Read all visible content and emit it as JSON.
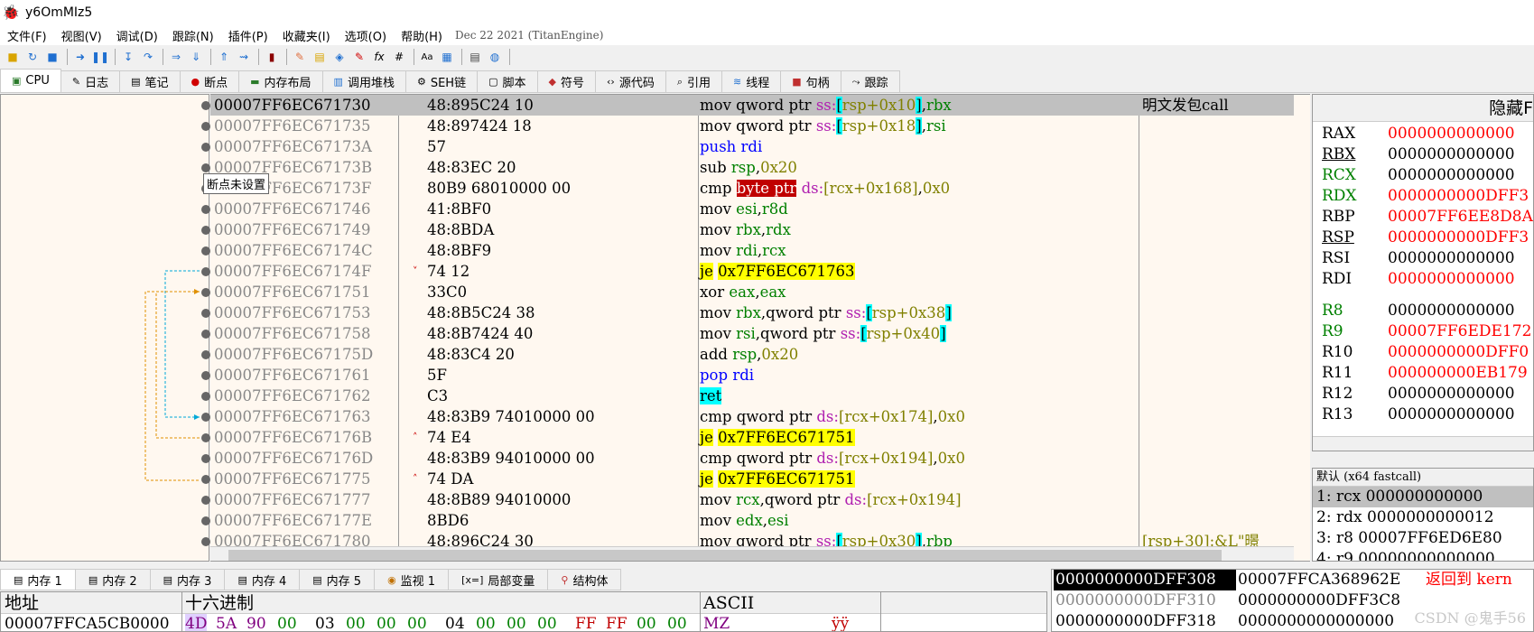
{
  "window": {
    "title": "y6OmMIz5"
  },
  "menu": {
    "items": [
      "文件(F)",
      "视图(V)",
      "调试(D)",
      "跟踪(N)",
      "插件(P)",
      "收藏夹(I)",
      "选项(O)",
      "帮助(H)"
    ],
    "build_info": "Dec 22 2021 (TitanEngine)"
  },
  "toolbar": {
    "icons": [
      "open-icon",
      "restart-icon",
      "stop-icon",
      "run-icon",
      "pause-icon",
      "step-into-icon",
      "step-over-icon",
      "trace-into-icon",
      "trace-over-icon",
      "run-to-user-icon",
      "animate-icon",
      "script-icon",
      "patch-icon",
      "comments-icon",
      "labels-icon",
      "bookmarks-icon",
      "functions-icon",
      "hash-icon",
      "font-icon",
      "calculator-icon",
      "notes-icon",
      "globe-icon"
    ]
  },
  "tabs": [
    {
      "label": "CPU",
      "icon": "cpu-icon"
    },
    {
      "label": "日志",
      "icon": "log-icon"
    },
    {
      "label": "笔记",
      "icon": "notes-icon"
    },
    {
      "label": "断点",
      "icon": "breakpoint-icon"
    },
    {
      "label": "内存布局",
      "icon": "memory-map-icon"
    },
    {
      "label": "调用堆栈",
      "icon": "callstack-icon"
    },
    {
      "label": "SEH链",
      "icon": "seh-icon"
    },
    {
      "label": "脚本",
      "icon": "script-icon"
    },
    {
      "label": "符号",
      "icon": "symbols-icon"
    },
    {
      "label": "源代码",
      "icon": "source-icon"
    },
    {
      "label": "引用",
      "icon": "references-icon"
    },
    {
      "label": "线程",
      "icon": "threads-icon"
    },
    {
      "label": "句柄",
      "icon": "handles-icon"
    },
    {
      "label": "跟踪",
      "icon": "trace-icon"
    }
  ],
  "tooltip": "断点未设置",
  "disasm": {
    "comment_first": "明文发包call",
    "comment_last": "[rsp+30]:&L\"暻",
    "rows": [
      {
        "addr": "00007FF6EC671730",
        "bytes": "48:895C24 10",
        "mark": ""
      },
      {
        "addr": "00007FF6EC671735",
        "bytes": "48:897424 18",
        "mark": ""
      },
      {
        "addr": "00007FF6EC67173A",
        "bytes": "57",
        "mark": ""
      },
      {
        "addr": "00007FF6EC67173B",
        "bytes": "48:83EC 20",
        "mark": ""
      },
      {
        "addr": "00007FF6EC67173F",
        "bytes": "80B9 68010000 00",
        "mark": ""
      },
      {
        "addr": "00007FF6EC671746",
        "bytes": "41:8BF0",
        "mark": ""
      },
      {
        "addr": "00007FF6EC671749",
        "bytes": "48:8BDA",
        "mark": ""
      },
      {
        "addr": "00007FF6EC67174C",
        "bytes": "48:8BF9",
        "mark": ""
      },
      {
        "addr": "00007FF6EC67174F",
        "bytes": "74 12",
        "mark": "˅"
      },
      {
        "addr": "00007FF6EC671751",
        "bytes": "33C0",
        "mark": ""
      },
      {
        "addr": "00007FF6EC671753",
        "bytes": "48:8B5C24 38",
        "mark": ""
      },
      {
        "addr": "00007FF6EC671758",
        "bytes": "48:8B7424 40",
        "mark": ""
      },
      {
        "addr": "00007FF6EC67175D",
        "bytes": "48:83C4 20",
        "mark": ""
      },
      {
        "addr": "00007FF6EC671761",
        "bytes": "5F",
        "mark": ""
      },
      {
        "addr": "00007FF6EC671762",
        "bytes": "C3",
        "mark": ""
      },
      {
        "addr": "00007FF6EC671763",
        "bytes": "48:83B9 74010000 00",
        "mark": ""
      },
      {
        "addr": "00007FF6EC67176B",
        "bytes": "74 E4",
        "mark": "˄"
      },
      {
        "addr": "00007FF6EC67176D",
        "bytes": "48:83B9 94010000 00",
        "mark": ""
      },
      {
        "addr": "00007FF6EC671775",
        "bytes": "74 DA",
        "mark": "˄"
      },
      {
        "addr": "00007FF6EC671777",
        "bytes": "48:8B89 94010000",
        "mark": ""
      },
      {
        "addr": "00007FF6EC67177E",
        "bytes": "8BD6",
        "mark": ""
      },
      {
        "addr": "00007FF6EC671780",
        "bytes": "48:896C24 30",
        "mark": ""
      }
    ],
    "instr": {
      "mov": "mov",
      "push": "push",
      "sub": "sub",
      "cmp": "cmp",
      "je": "je",
      "xor": "xor",
      "add": "add",
      "pop": "pop",
      "ret": "ret",
      "qword_ptr": "qword ptr",
      "byte_ptr": "byte ptr",
      "ss": "ss:",
      "ds": "ds:",
      "rsp10": "rsp+0x10",
      "rsp18": "rsp+0x18",
      "rsp38": "rsp+0x38",
      "rsp40": "rsp+0x40",
      "rsp30": "rsp+0x30",
      "rcx168": "[rcx+0x168]",
      "rcx174": "[rcx+0x174]",
      "rcx194": "[rcx+0x194]",
      "jt1": "0x7FF6EC671763",
      "jt2": "0x7FF6EC671751",
      "rbx": "rbx",
      "rsi": "rsi",
      "rdi": "rdi",
      "rsp": "rsp",
      "esi": "esi",
      "r8d": "r8d",
      "rdx": "rdx",
      "rcx": "rcx",
      "eax": "eax",
      "edx": "edx",
      "rbp": "rbp",
      "n20": "0x20",
      "n0": "0x0"
    }
  },
  "registers": {
    "header": "隐藏F",
    "rows": [
      {
        "name": "RAX",
        "value": "0000000000000",
        "changed": true
      },
      {
        "name": "RBX",
        "value": "0000000000000",
        "changed": false
      },
      {
        "name": "RCX",
        "value": "0000000000000",
        "changed": false
      },
      {
        "name": "RDX",
        "value": "0000000000DFF3",
        "changed": true
      },
      {
        "name": "RBP",
        "value": "00007FF6EE8D8A",
        "changed": true
      },
      {
        "name": "RSP",
        "value": "0000000000DFF3",
        "changed": true
      },
      {
        "name": "RSI",
        "value": "0000000000000",
        "changed": false
      },
      {
        "name": "RDI",
        "value": "0000000000000",
        "changed": true
      },
      {
        "name": "R8",
        "value": "0000000000000",
        "changed": false
      },
      {
        "name": "R9",
        "value": "00007FF6EDE172",
        "changed": true
      },
      {
        "name": "R10",
        "value": "0000000000DFF0",
        "changed": true
      },
      {
        "name": "R11",
        "value": "000000000EB179",
        "changed": true
      },
      {
        "name": "R12",
        "value": "0000000000000",
        "changed": false
      },
      {
        "name": "R13",
        "value": "0000000000000",
        "changed": false
      }
    ]
  },
  "callconv": {
    "header": "默认 (x64 fastcall)",
    "rows": [
      "1: rcx 000000000000",
      "2: rdx 0000000000012",
      "3: r8 00007FF6ED6E80",
      "4: r9 00000000000000"
    ]
  },
  "lower_tabs": [
    {
      "label": "内存 1",
      "icon": "dump-icon"
    },
    {
      "label": "内存 2",
      "icon": "dump-icon"
    },
    {
      "label": "内存 3",
      "icon": "dump-icon"
    },
    {
      "label": "内存 4",
      "icon": "dump-icon"
    },
    {
      "label": "内存 5",
      "icon": "dump-icon"
    },
    {
      "label": "监视 1",
      "icon": "watch-icon"
    },
    {
      "label": "局部变量",
      "icon": "locals-icon"
    },
    {
      "label": "结构体",
      "icon": "struct-icon"
    }
  ],
  "dump": {
    "headers": {
      "addr": "地址",
      "hex": "十六进制",
      "ascii": "ASCII"
    },
    "row": {
      "addr": "00007FFCA5CB0000",
      "bytes": [
        "4D",
        "5A",
        "90",
        "00",
        "03",
        "00",
        "00",
        "00",
        "04",
        "00",
        "00",
        "00",
        "FF",
        "FF",
        "00",
        "00"
      ],
      "ascii": "MZ",
      "ascii_tail": "ÿÿ"
    }
  },
  "stack": {
    "rows": [
      {
        "addr": "0000000000DFF308",
        "value": "00007FFCA368962E",
        "comment": "返回到 kern",
        "selected": true,
        "dim": false
      },
      {
        "addr": "0000000000DFF310",
        "value": "0000000000DFF3C8",
        "comment": "",
        "selected": false,
        "dim": true
      },
      {
        "addr": "0000000000DFF318",
        "value": "0000000000000000",
        "comment": "",
        "selected": false,
        "dim": false
      }
    ]
  },
  "watermark": "CSDN @鬼手56"
}
